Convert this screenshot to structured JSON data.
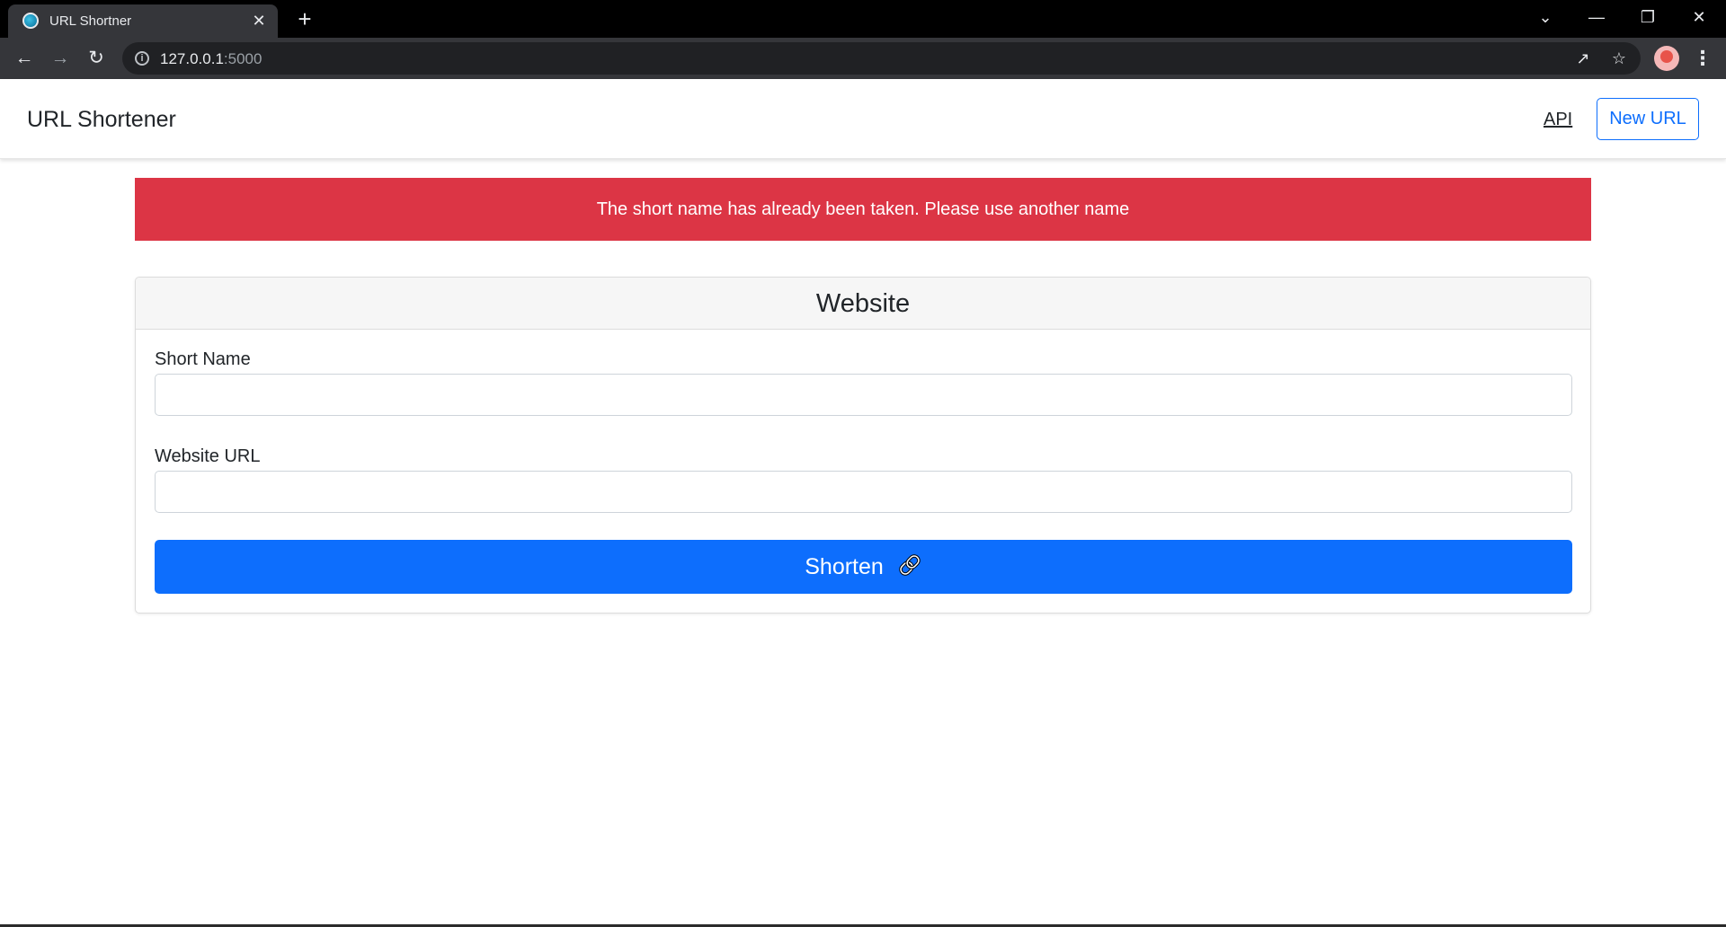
{
  "browser": {
    "tab_title": "URL Shortner",
    "tab_close": "✕",
    "new_tab": "+",
    "url_host": "127.0.0.1",
    "url_port": ":5000",
    "window_controls": {
      "tabsearch": "⌄",
      "minimize": "—",
      "restore": "❐",
      "close": "✕"
    }
  },
  "navbar": {
    "brand": "URL Shortener",
    "api_link": "API",
    "new_url_button": "New URL"
  },
  "alert": {
    "message": "The short name has already been taken. Please use another name",
    "color": "#dc3545"
  },
  "form": {
    "title": "Website",
    "short_name_label": "Short Name",
    "short_name_value": "",
    "website_url_label": "Website URL",
    "website_url_value": "",
    "submit_label": "Shorten",
    "submit_icon": "link-icon",
    "accent_color": "#0d6efd"
  }
}
